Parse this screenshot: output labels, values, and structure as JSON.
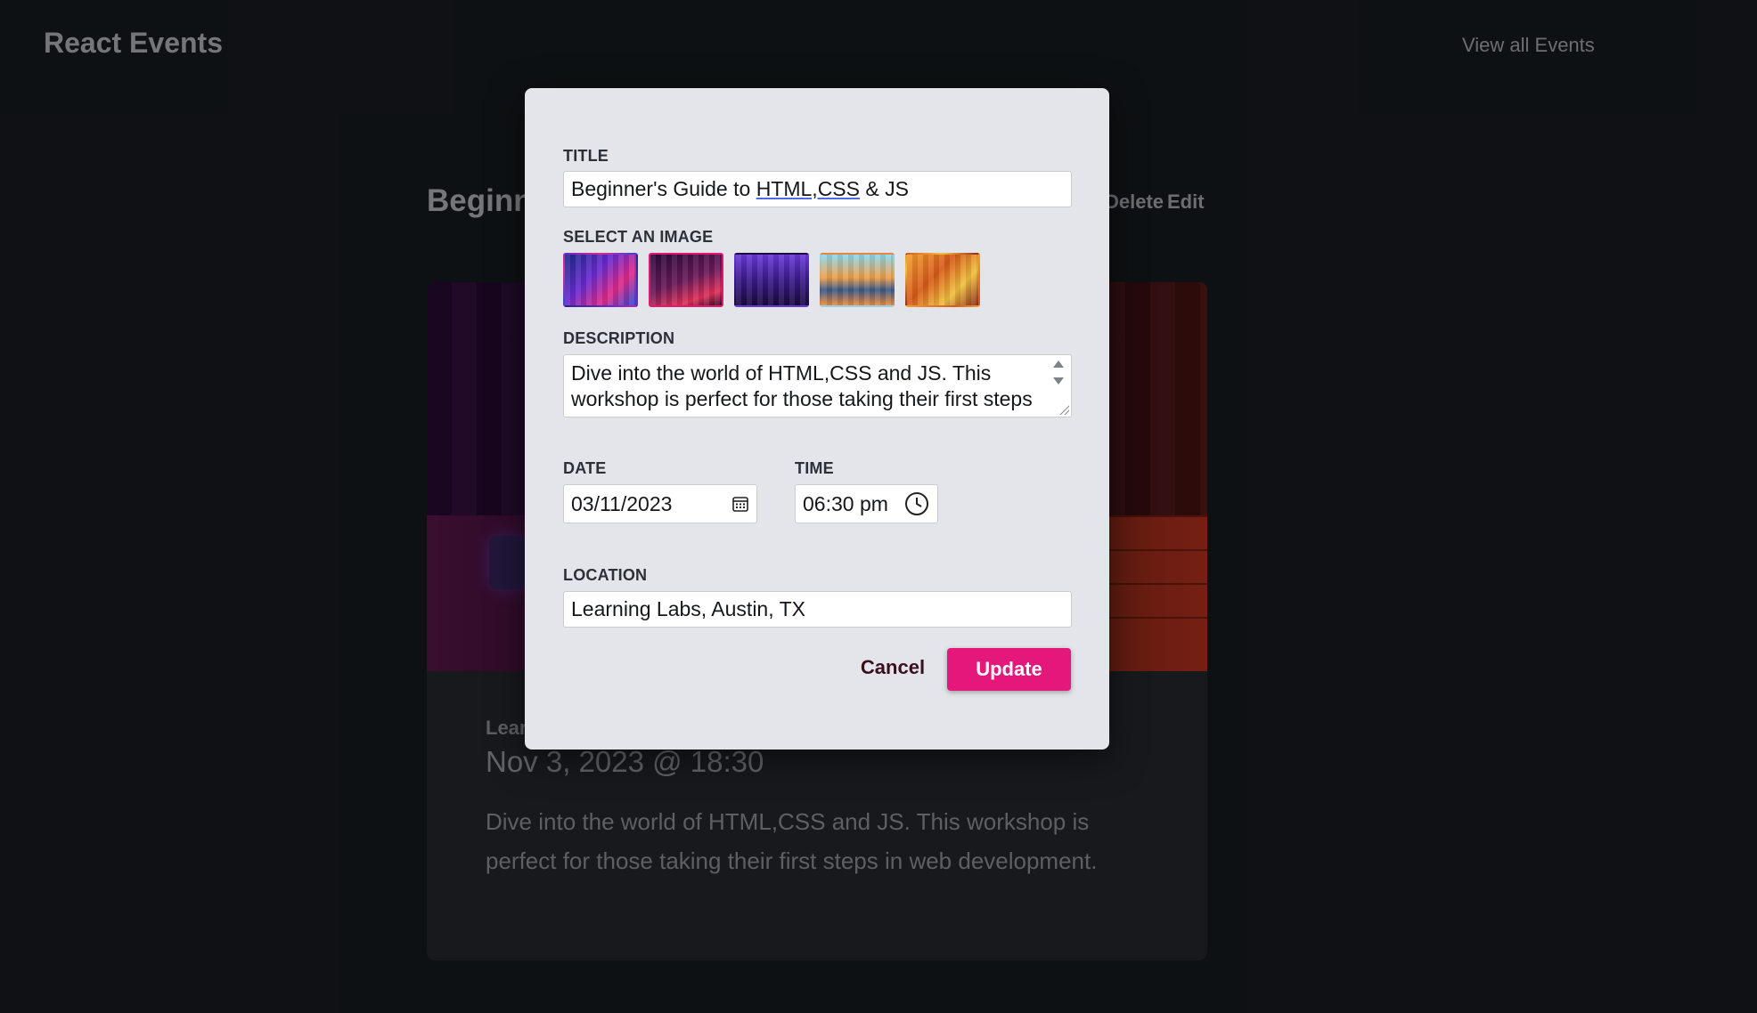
{
  "app": {
    "brand": "React Events",
    "nav_view_all": "View all Events"
  },
  "event": {
    "title": "Beginner's Guide to HTML,CSS & JS",
    "delete_label": "Delete",
    "edit_label": "Edit",
    "location": "Learning Labs, Austin, TX",
    "datetime": "Nov 3, 2023 @ 18:30",
    "description": "Dive into the world of HTML,CSS and JS. This workshop is perfect for those taking their first steps in web development."
  },
  "modal": {
    "title_label": "TITLE",
    "title_value_pre": "Beginner's Guide to ",
    "title_value_underlined": "HTML,CSS",
    "title_value_post": " & JS",
    "image_label": "SELECT AN IMAGE",
    "images": [
      {
        "name": "neon-city",
        "selected": false
      },
      {
        "name": "workstation",
        "selected": true
      },
      {
        "name": "concert",
        "selected": false
      },
      {
        "name": "city-lake",
        "selected": false
      },
      {
        "name": "people-laptop",
        "selected": false
      }
    ],
    "description_label": "DESCRIPTION",
    "description_value": "Dive into the world of HTML,CSS and JS. This workshop is perfect for those taking their first steps in web development.",
    "date_label": "DATE",
    "date_value": "03/11/2023",
    "time_label": "TIME",
    "time_value": "06:30 pm",
    "location_label": "LOCATION",
    "location_value": "Learning Labs, Austin, TX",
    "cancel_label": "Cancel",
    "update_label": "Update"
  },
  "colors": {
    "accent": "#e3187a",
    "background": "#1b1f24",
    "modal_bg": "#e3e5ea"
  }
}
